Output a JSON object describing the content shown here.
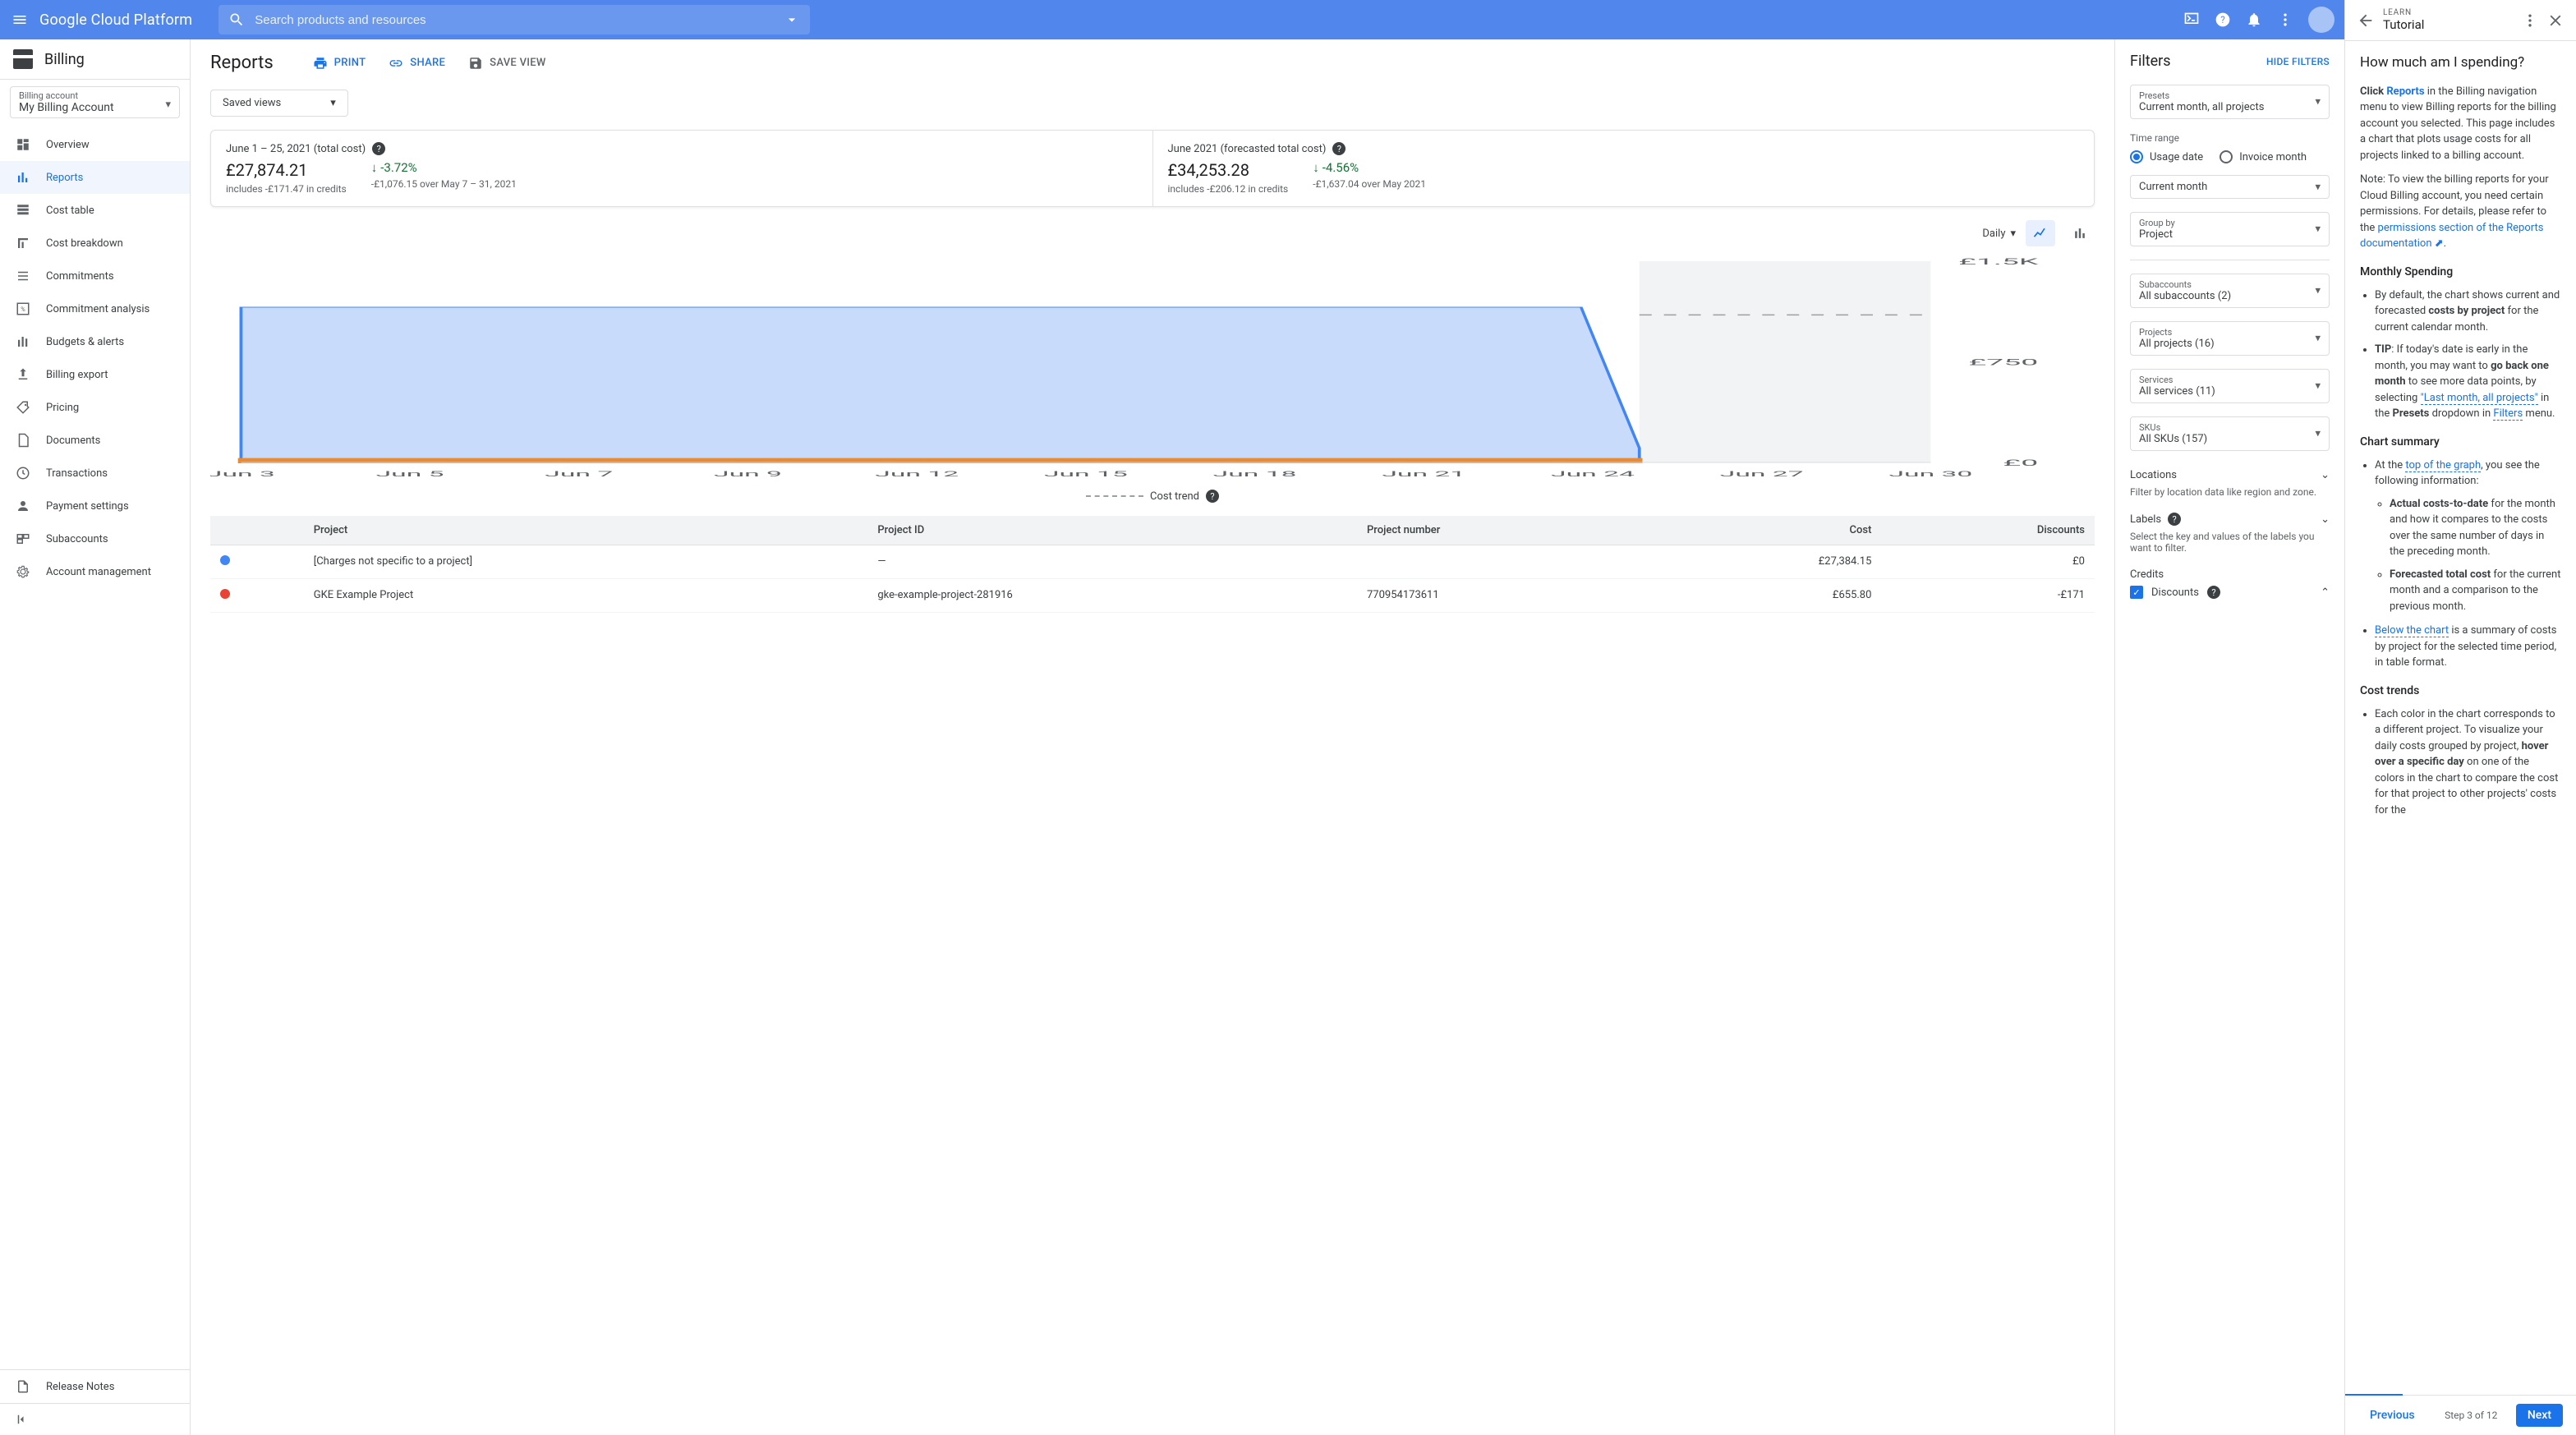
{
  "header": {
    "brand": "Google Cloud Platform",
    "search_placeholder": "Search products and resources"
  },
  "sidebar": {
    "title": "Billing",
    "account_label": "Billing account",
    "account_value": "My Billing Account",
    "items": [
      {
        "label": "Overview",
        "icon": "dashboard"
      },
      {
        "label": "Reports",
        "icon": "bar-chart",
        "active": true
      },
      {
        "label": "Cost table",
        "icon": "table"
      },
      {
        "label": "Cost breakdown",
        "icon": "breakdown"
      },
      {
        "label": "Commitments",
        "icon": "list"
      },
      {
        "label": "Commitment analysis",
        "icon": "percent"
      },
      {
        "label": "Budgets & alerts",
        "icon": "budget"
      },
      {
        "label": "Billing export",
        "icon": "export"
      },
      {
        "label": "Pricing",
        "icon": "tag"
      },
      {
        "label": "Documents",
        "icon": "document"
      },
      {
        "label": "Transactions",
        "icon": "clock"
      },
      {
        "label": "Payment settings",
        "icon": "person"
      },
      {
        "label": "Subaccounts",
        "icon": "subaccount"
      },
      {
        "label": "Account management",
        "icon": "gear"
      }
    ],
    "release_notes": "Release Notes"
  },
  "reports": {
    "title": "Reports",
    "actions": {
      "print": "PRINT",
      "share": "SHARE",
      "save_view": "SAVE VIEW"
    },
    "saved_views": "Saved views",
    "summary": [
      {
        "title": "June 1 – 25, 2021 (total cost)",
        "amount": "£27,874.21",
        "sub": "includes -£171.47 in credits",
        "delta": "-3.72%",
        "delta_sub": "-£1,076.15 over May 7 – 31, 2021"
      },
      {
        "title": "June 2021 (forecasted total cost)",
        "amount": "£34,253.28",
        "sub": "includes -£206.12 in credits",
        "delta": "-4.56%",
        "delta_sub": "-£1,637.04 over May 2021"
      }
    ],
    "chart_controls": {
      "granularity": "Daily"
    },
    "chart_legend": "Cost trend",
    "table": {
      "headers": [
        "",
        "Project",
        "Project ID",
        "Project number",
        "Cost",
        "Discounts"
      ],
      "rows": [
        {
          "color": "#4285f4",
          "project": "[Charges not specific to a project]",
          "project_id": "—",
          "project_number": "",
          "cost": "£27,384.15",
          "discounts": "£0"
        },
        {
          "color": "#ea4335",
          "project": "GKE Example Project",
          "project_id": "gke-example-project-281916",
          "project_number": "770954173611",
          "cost": "£655.80",
          "discounts": "-£171"
        }
      ]
    }
  },
  "chart_data": {
    "type": "area",
    "title": "",
    "xlabel": "",
    "ylabel": "",
    "y_ticks": [
      "£0",
      "£750",
      "£1.5K"
    ],
    "ylim": [
      0,
      1500
    ],
    "x_categories": [
      "Jun 3",
      "Jun 5",
      "Jun 7",
      "Jun 9",
      "Jun 12",
      "Jun 15",
      "Jun 18",
      "Jun 21",
      "Jun 24",
      "Jun 27",
      "Jun 30"
    ],
    "series": [
      {
        "name": "[Charges not specific to a project]",
        "color": "#4285f4",
        "values": [
          1130,
          1130,
          1130,
          1130,
          1130,
          1130,
          1130,
          1130,
          1130,
          1130,
          1130,
          1130,
          1130,
          1130,
          1130,
          1130,
          1130,
          1130,
          1130,
          1130,
          1130,
          1130,
          1130,
          1130,
          80
        ]
      },
      {
        "name": "GKE Example Project",
        "color": "#ea4335",
        "values": [
          27,
          27,
          27,
          27,
          27,
          27,
          27,
          27,
          27,
          27,
          27,
          27,
          27,
          27,
          27,
          27,
          27,
          27,
          27,
          27,
          27,
          27,
          27,
          27,
          27
        ]
      }
    ],
    "forecast_trend": 1100,
    "forecast_days": [
      "Jun 25",
      "Jun 30"
    ]
  },
  "filters": {
    "title": "Filters",
    "hide": "HIDE FILTERS",
    "presets": {
      "label": "Presets",
      "value": "Current month, all projects"
    },
    "time_range_label": "Time range",
    "time_range_options": [
      "Usage date",
      "Invoice month"
    ],
    "time_range_selected": "Usage date",
    "time_range_value": "Current month",
    "group_by": {
      "label": "Group by",
      "value": "Project"
    },
    "subaccounts": {
      "label": "Subaccounts",
      "value": "All subaccounts (2)"
    },
    "projects": {
      "label": "Projects",
      "value": "All projects (16)"
    },
    "services": {
      "label": "Services",
      "value": "All services (11)"
    },
    "skus": {
      "label": "SKUs",
      "value": "All SKUs (157)"
    },
    "locations": {
      "label": "Locations",
      "sub": "Filter by location data like region and zone."
    },
    "labels": {
      "label": "Labels",
      "sub": "Select the key and values of the labels you want to filter."
    },
    "credits": {
      "label": "Credits",
      "discounts": "Discounts"
    }
  },
  "tutorial": {
    "learn": "LEARN",
    "title": "Tutorial",
    "heading": "How much am I spending?",
    "prev": "Previous",
    "next": "Next",
    "step": "Step 3 of 12",
    "monthly_heading": "Monthly Spending",
    "chart_summary_heading": "Chart summary",
    "cost_trends_heading": "Cost trends"
  }
}
